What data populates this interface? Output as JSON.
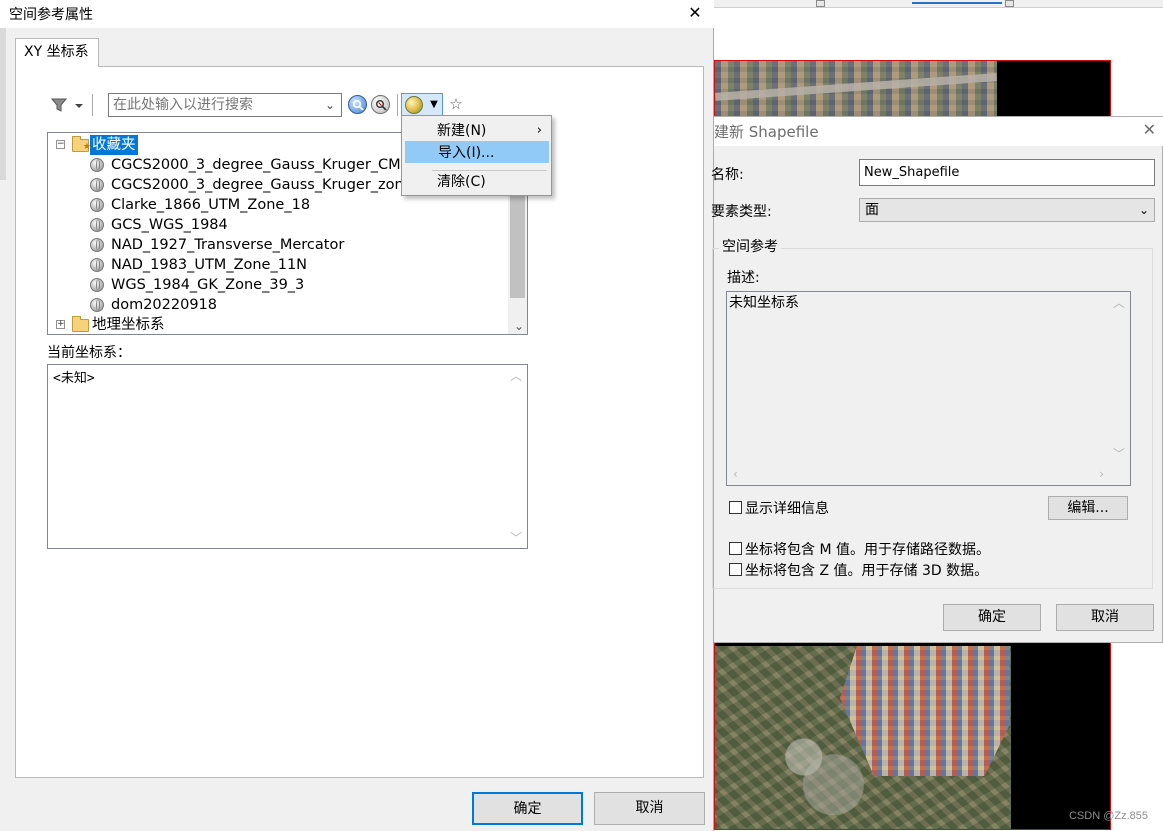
{
  "spatial_ref_dialog": {
    "title": "空间参考属性",
    "close_glyph": "✕",
    "tab_label": "XY 坐标系",
    "search_placeholder": "在此处输入以进行搜索",
    "tree": {
      "favorites_label": "收藏夹",
      "favorites_expander": "−",
      "items": [
        "CGCS2000_3_degree_Gauss_Kruger_CM",
        "CGCS2000_3_degree_Gauss_Kruger_zon",
        "Clarke_1866_UTM_Zone_18",
        "GCS_WGS_1984",
        "NAD_1927_Transverse_Mercator",
        "NAD_1983_UTM_Zone_11N",
        "WGS_1984_GK_Zone_39_3",
        "dom20220918"
      ],
      "geographic_label": "地理坐标系",
      "geographic_expander": "+"
    },
    "current_label": "当前坐标系：",
    "current_value": "<未知>",
    "ok_label": "确定",
    "cancel_label": "取消"
  },
  "context_menu": {
    "items": [
      "新建(N)",
      "导入(I)...",
      "清除(C)"
    ],
    "submenu_arrow": "›",
    "highlighted_index": 1
  },
  "new_shapefile_dialog": {
    "title": "建新 Shapefile",
    "close_glyph": "✕",
    "name_label": "名称:",
    "name_value": "New_Shapefile",
    "type_label": "要素类型:",
    "type_value": "面",
    "spatial_ref_group": "空间参考",
    "desc_label": "描述:",
    "desc_value": "未知坐标系",
    "show_details_label": "显示详细信息",
    "edit_label": "编辑...",
    "m_values_label": "坐标将包含 M 值。用于存储路径数据。",
    "z_values_label": "坐标将包含 Z 值。用于存储 3D 数据。",
    "ok_label": "确定",
    "cancel_label": "取消"
  },
  "watermark": "CSDN @Zz.855",
  "colors": {
    "selection": "#0078d7",
    "menu_highlight": "#91c9f7",
    "map_border": "#d01010"
  }
}
